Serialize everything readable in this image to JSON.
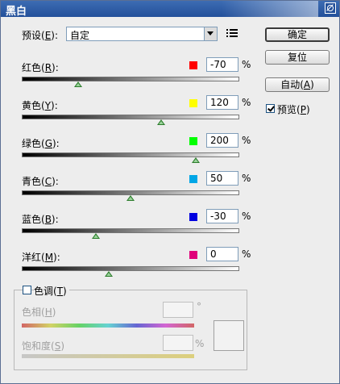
{
  "window": {
    "title": "黑白"
  },
  "preset": {
    "label": "预设(E):",
    "value": "自定"
  },
  "buttons": {
    "ok": "确定",
    "reset": "复位",
    "auto": "自动(A)"
  },
  "preview": {
    "label": "预览(P)",
    "checked": true
  },
  "sliders": [
    {
      "key": "red",
      "label": "红色(R):",
      "value": "-70",
      "unit": "%",
      "color": "#ff0000",
      "thumb_fraction": 0.26
    },
    {
      "key": "yellow",
      "label": "黄色(Y):",
      "value": "120",
      "unit": "%",
      "color": "#ffff00",
      "thumb_fraction": 0.64
    },
    {
      "key": "green",
      "label": "绿色(G):",
      "value": "200",
      "unit": "%",
      "color": "#00ff00",
      "thumb_fraction": 0.8
    },
    {
      "key": "cyan",
      "label": "青色(C):",
      "value": "50",
      "unit": "%",
      "color": "#00a6e6",
      "thumb_fraction": 0.5
    },
    {
      "key": "blue",
      "label": "蓝色(B):",
      "value": "-30",
      "unit": "%",
      "color": "#0000e0",
      "thumb_fraction": 0.34
    },
    {
      "key": "magenta",
      "label": "洋红(M):",
      "value": "0",
      "unit": "%",
      "color": "#e0007a",
      "thumb_fraction": 0.4
    }
  ],
  "tint": {
    "label": "色调(T)",
    "checked": false,
    "hue_label": "色相(H)",
    "hue_unit": "°",
    "saturation_label": "饱和度(S)",
    "saturation_unit": "%"
  }
}
